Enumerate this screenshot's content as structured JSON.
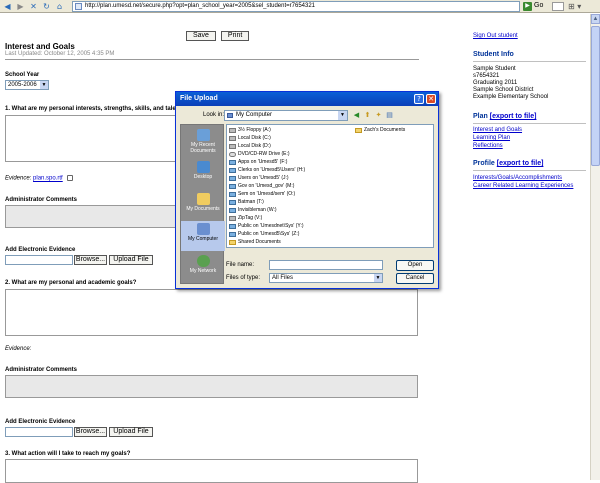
{
  "browser": {
    "address": "http://plan.umesd.net/secure.php?opt=plan_school_year=2005&sel_student=r7654321",
    "go_label": "Go"
  },
  "main": {
    "save_label": "Save",
    "print_label": "Print",
    "title": "Interest and Goals",
    "updated": "Last Updated: October 12, 2005 4:35 PM",
    "school_year_label": "School Year",
    "school_year_value": "2005-2006",
    "q1": "1. What are my personal interests, strengths, skills, and talents?",
    "evidence_label": "Evidence:",
    "evidence_file": "plan.spo.rtf",
    "admin_comments": "Administrator Comments",
    "add_evidence": "Add Electronic Evidence",
    "browse_label": "Browse...",
    "upload_label": "Upload File",
    "q2": "2. What are my personal and academic goals?",
    "evidence2_label": "Evidence:",
    "admin_comments2": "Administrator Comments",
    "add_evidence2": "Add Electronic Evidence",
    "browse2_label": "Browse...",
    "upload2_label": "Upload File",
    "q3": "3. What action will I take to reach my goals?"
  },
  "sidebar": {
    "signout": "Sign Out student",
    "student_info_heading": "Student Info",
    "student_lines": [
      "Sample Student",
      "s7654321",
      "Graduating 2011",
      "Sample School District",
      "Example Elementary School"
    ],
    "plan_heading": "Plan",
    "plan_export": "[export to file]",
    "plan_links": [
      "Interest and Goals",
      "Learning Plan",
      "Reflections"
    ],
    "profile_heading": "Profile",
    "profile_export": "[export to file]",
    "profile_links": [
      "Interests/Goals/Accomplishments",
      "Career Related Learning Experiences"
    ]
  },
  "dialog": {
    "title": "File Upload",
    "look_in_label": "Look in:",
    "look_in_value": "My Computer",
    "places": [
      "My Recent Documents",
      "Desktop",
      "My Documents",
      "My Computer",
      "My Network"
    ],
    "items_col1": [
      "3½ Floppy (A:)",
      "Local Disk (C:)",
      "Local Disk (D:)",
      "DVD/CD-RW Drive (E:)",
      "Apps on 'Umesd5' (F:)",
      "Clerks on 'Umesd5\\Users' (H:)",
      "Users on 'Umesd5' (J:)",
      "Gov on 'Umesd_gov' (M:)",
      "Sem on 'Umesd/sem' (O:)",
      "Batman (T:)",
      "Invisibleman (W:)",
      "ZipTag (V:)",
      "Public on 'Umesdnet\\Sys' (Y:)",
      "Public on 'Umesd5\\Sys' (Z:)",
      "Shared Documents"
    ],
    "items_col2": [
      "Zach's Documents"
    ],
    "file_name_label": "File name:",
    "file_name_value": "",
    "file_type_label": "Files of type:",
    "file_type_value": "All Files",
    "open_label": "Open",
    "cancel_label": "Cancel"
  },
  "icons": {
    "back": "back-arrow-icon",
    "forward": "forward-arrow-icon",
    "stop": "stop-icon",
    "refresh": "refresh-icon",
    "home": "home-icon"
  }
}
